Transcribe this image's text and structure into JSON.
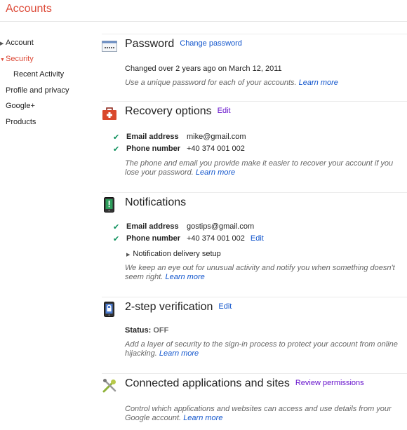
{
  "app": {
    "title": "Accounts"
  },
  "sidebar": {
    "items": [
      {
        "label": "Account",
        "has_arrow": true
      },
      {
        "label": "Security",
        "has_arrow": true,
        "active": true
      },
      {
        "label": "Recent Activity"
      },
      {
        "label": "Profile and privacy"
      },
      {
        "label": "Google+"
      },
      {
        "label": "Products"
      }
    ]
  },
  "colors": {
    "brand_red": "#dd4b39",
    "link_blue": "#1155cc",
    "link_visited": "#6611cc",
    "check_green": "#0a8f5a"
  },
  "password": {
    "title": "Password",
    "link": "Change password",
    "changed_text": "Changed over 2 years ago on March 12, 2011",
    "note": "Use a unique password for each of your accounts.",
    "learn_more": "Learn more",
    "icon": "password-dots-icon"
  },
  "recovery": {
    "title": "Recovery options",
    "link": "Edit",
    "icon": "first-aid-kit-icon",
    "email_label": "Email address",
    "email_value": "mike@gmail.com",
    "phone_label": "Phone number",
    "phone_value": "+40 374 001 002",
    "note": "The phone and email you provide make it easier to recover your account if you lose your password.",
    "learn_more": "Learn more"
  },
  "notifications": {
    "title": "Notifications",
    "icon": "phone-alert-icon",
    "email_label": "Email address",
    "email_value": "gostips@gmail.com",
    "phone_label": "Phone number",
    "phone_value": "+40 374 001 002",
    "phone_edit": "Edit",
    "delivery_setup": "Notification delivery setup",
    "note": "We keep an eye out for unusual activity and notify you when something doesn't seem right.",
    "learn_more": "Learn more"
  },
  "two_step": {
    "title": "2-step verification",
    "link": "Edit",
    "icon": "lock-phone-icon",
    "status_label": "Status:",
    "status_value": "OFF",
    "note": "Add a layer of security to the sign-in process to protect your account from online hijacking.",
    "learn_more": "Learn more"
  },
  "connected": {
    "title": "Connected applications and sites",
    "link": "Review permissions",
    "icon": "tools-icon",
    "note": "Control which applications and websites can access and use details from your Google account.",
    "learn_more": "Learn more"
  }
}
